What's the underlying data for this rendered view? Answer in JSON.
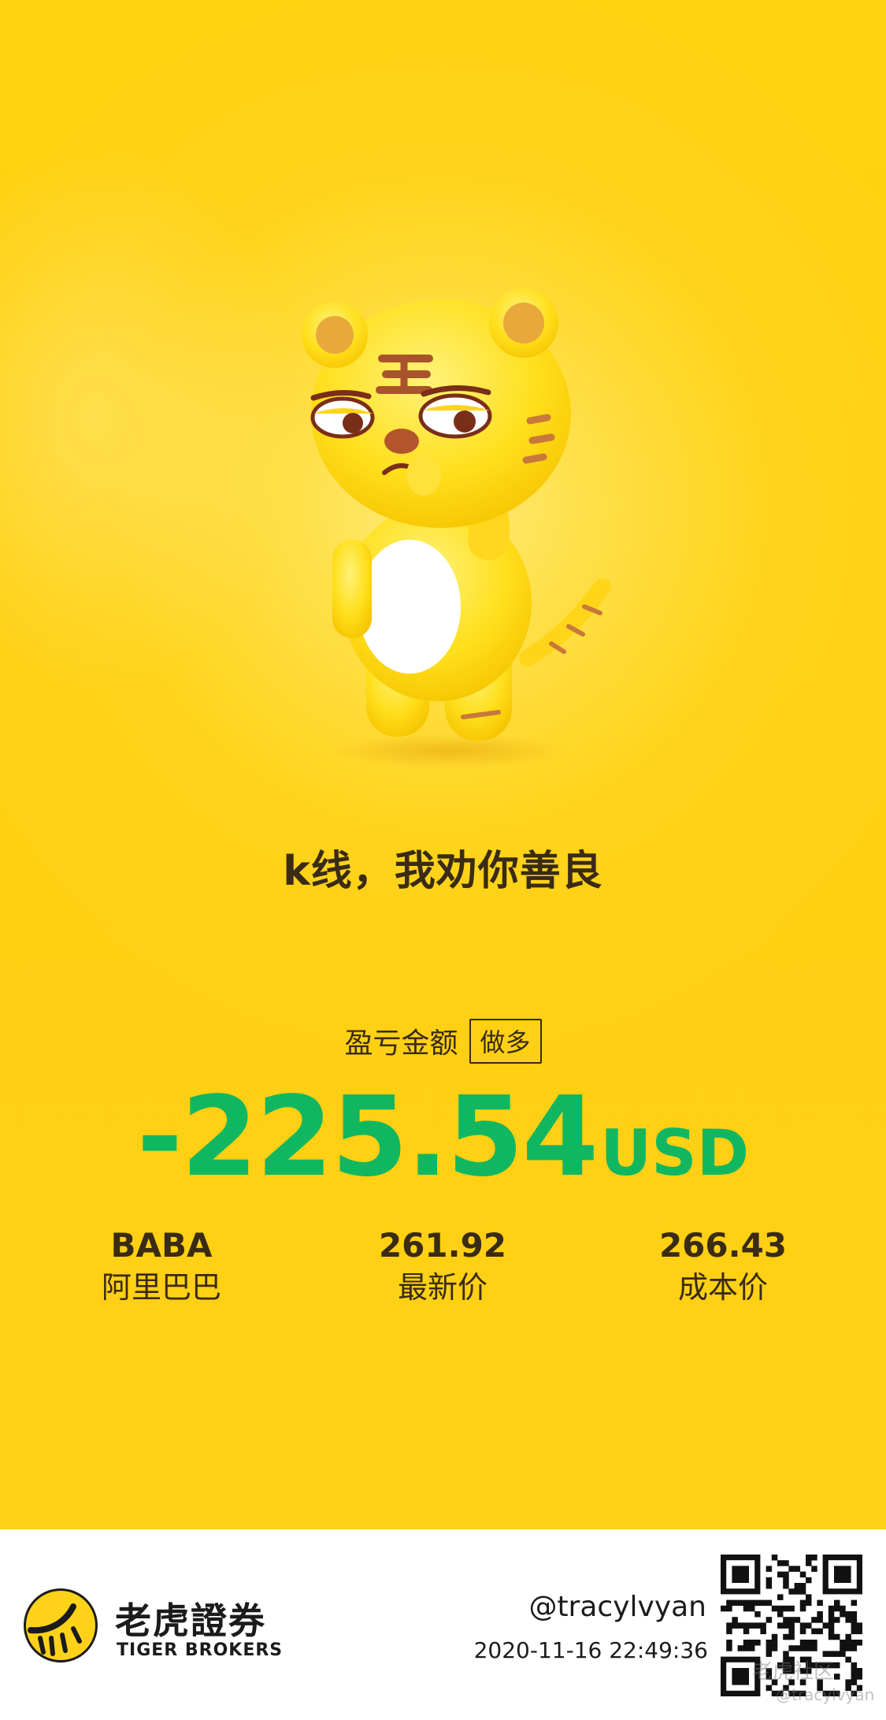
{
  "caption": "k线，我劝你善良",
  "profit_loss": {
    "label": "盈亏金额",
    "position_badge": "做多",
    "amount": "-225.54",
    "currency": "USD",
    "color": "#11b760"
  },
  "stats": [
    {
      "value": "BABA",
      "label": "阿里巴巴"
    },
    {
      "value": "261.92",
      "label": "最新价"
    },
    {
      "value": "266.43",
      "label": "成本价"
    }
  ],
  "footer": {
    "brand_cn": "老虎證券",
    "brand_en": "TIGER BROKERS",
    "handle": "@tracylvyan",
    "timestamp": "2020-11-16 22:49:36",
    "watermark_community": "老虎社区",
    "watermark_handle": "@tracylvyan"
  },
  "colors": {
    "background_yellow": "#ffcf12",
    "text_dark": "#3a2b14",
    "loss_green": "#11b760",
    "footer_bg": "#ffffff"
  },
  "icons": {
    "mascot": "tiger-mascot-icon",
    "logo": "tiger-brokers-logo-icon",
    "qr": "qr-code-icon"
  }
}
